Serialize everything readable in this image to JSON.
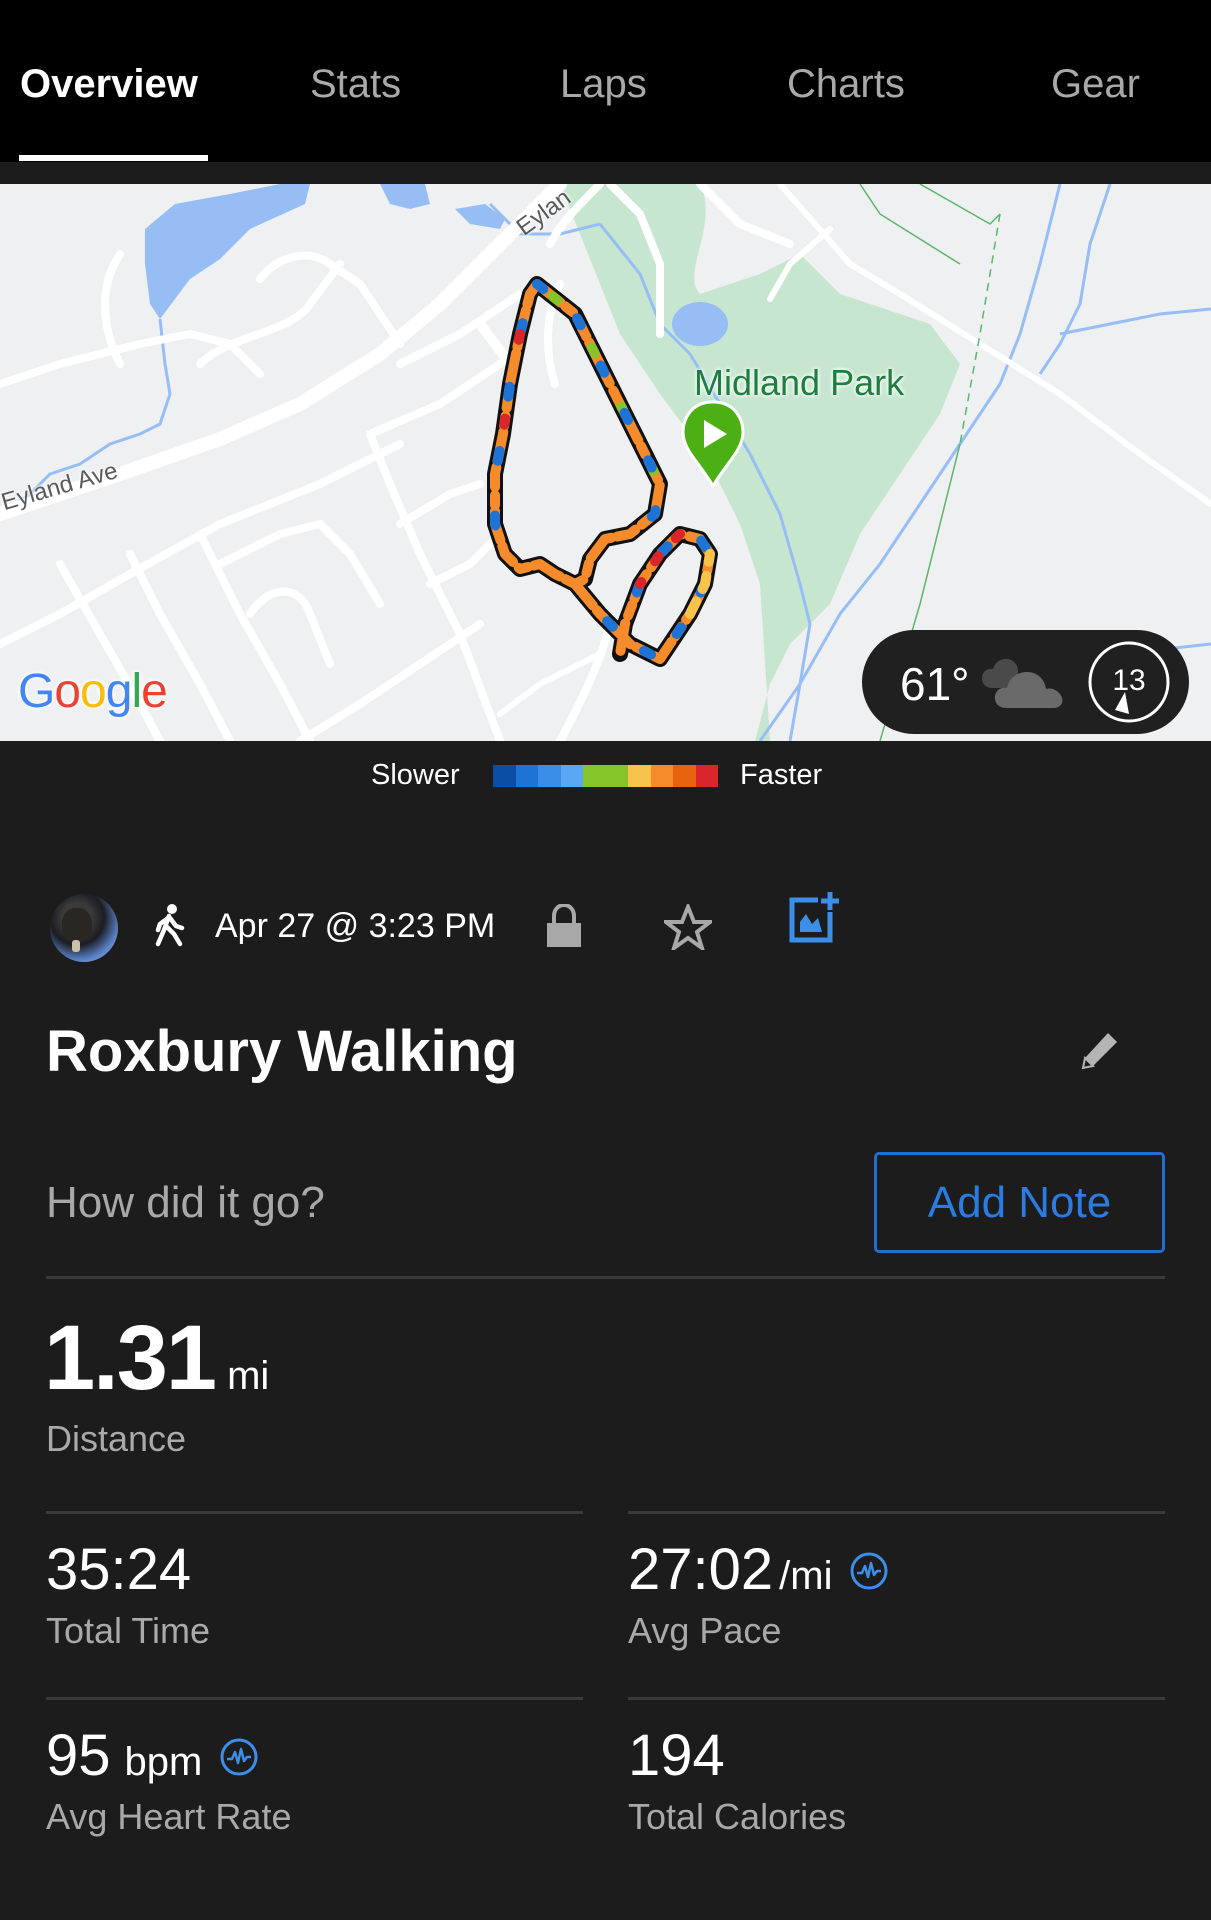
{
  "tabs": [
    {
      "label": "Overview",
      "active": true
    },
    {
      "label": "Stats",
      "active": false
    },
    {
      "label": "Laps",
      "active": false
    },
    {
      "label": "Charts",
      "active": false
    },
    {
      "label": "Gear",
      "active": false
    }
  ],
  "map": {
    "road_labels": [
      "Eyland Ave",
      "Eylan"
    ],
    "park_label": "Midland Park",
    "attribution": "Google",
    "start_marker": "play-icon",
    "weather": {
      "temperature": "61°",
      "condition_icon": "cloudy-icon",
      "wind_speed": "13"
    }
  },
  "legend": {
    "slower_label": "Slower",
    "faster_label": "Faster",
    "colors": [
      "#0a4ea6",
      "#1e74d6",
      "#3a8ee8",
      "#5aa8f5",
      "#86c52a",
      "#f7c34a",
      "#f68b2b",
      "#e8630f",
      "#d8262a"
    ]
  },
  "activity": {
    "avatar": "user-avatar",
    "type_icon": "walking-icon",
    "date_time": "Apr 27 @ 3:23 PM",
    "privacy_icon": "lock-icon",
    "favorite_icon": "star-icon",
    "add_photo_icon": "add-photo-icon",
    "title": "Roxbury Walking",
    "note_prompt": "How did it go?",
    "add_note_label": "Add Note"
  },
  "stats": {
    "distance": {
      "value": "1.31",
      "unit": "mi",
      "label": "Distance"
    },
    "total_time": {
      "value": "35:24",
      "unit": "",
      "label": "Total Time"
    },
    "avg_pace": {
      "value": "27:02",
      "unit": "/mi",
      "label": "Avg Pace"
    },
    "avg_heart_rate": {
      "value": "95",
      "unit": "bpm",
      "label": "Avg Heart Rate"
    },
    "total_calories": {
      "value": "194",
      "unit": "",
      "label": "Total Calories"
    }
  },
  "colors": {
    "accent_blue": "#2b7be0",
    "start_marker_green": "#4caf14",
    "background": "#1c1c1c",
    "tab_bar": "#000000"
  }
}
